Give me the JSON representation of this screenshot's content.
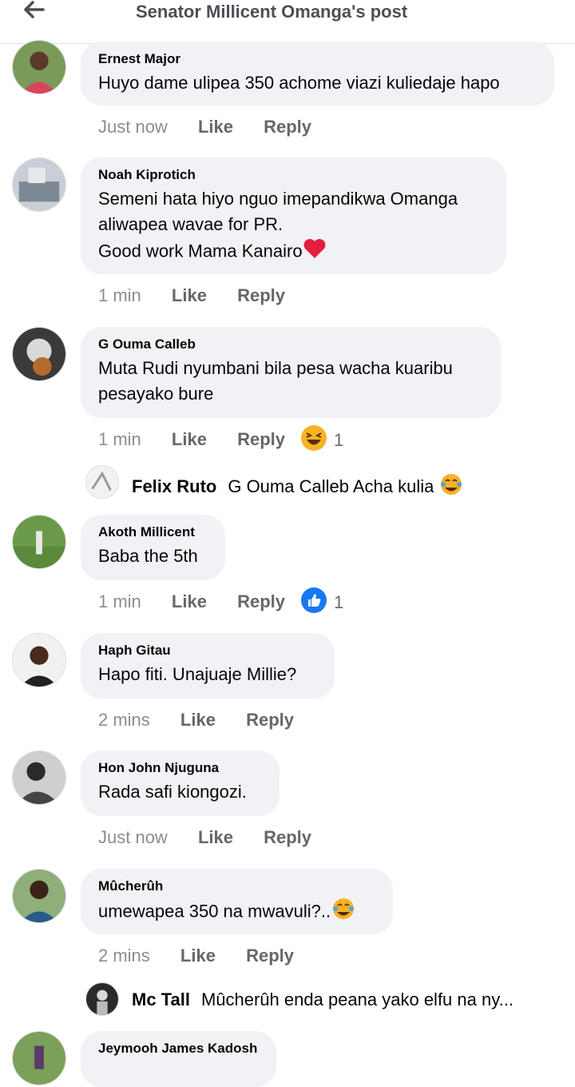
{
  "header": {
    "title": "Senator Millicent Omanga's post"
  },
  "comments": [
    {
      "author": "Ernest Major",
      "lines": [
        "Huyo dame ulipea 350 achome viazi kuliedaje hapo"
      ],
      "time": "Just now",
      "like": "Like",
      "reply": "Reply"
    },
    {
      "author": "Noah Kiprotich",
      "lines": [
        "Semeni hata hiyo nguo imepandikwa Omanga",
        "aliwapea wavae for PR.",
        "Good work Mama Kanairo"
      ],
      "time": "1 min",
      "like": "Like",
      "reply": "Reply"
    },
    {
      "author": "G Ouma Calleb",
      "lines": [
        "Muta Rudi nyumbani bila pesa wacha kuaribu",
        "pesayako bure"
      ],
      "time": "1 min",
      "like": "Like",
      "reply": "Reply",
      "reaction_count": "1"
    },
    {
      "author": "Akoth Millicent",
      "lines": [
        "Baba the 5th"
      ],
      "time": "1 min",
      "like": "Like",
      "reply": "Reply",
      "reaction_count": "1"
    },
    {
      "author": "Haph Gitau",
      "lines": [
        "Hapo fiti. Unajuaje Millie?"
      ],
      "time": "2 mins",
      "like": "Like",
      "reply": "Reply"
    },
    {
      "author": "Hon John Njuguna",
      "lines": [
        "Rada safi kiongozi."
      ],
      "time": "Just now",
      "like": "Like",
      "reply": "Reply"
    },
    {
      "author": "Mûcherûh",
      "lines": [
        "umewapea 350 na mwavuli?.."
      ],
      "time": "2 mins",
      "like": "Like",
      "reply": "Reply"
    },
    {
      "author": "Jeymooh James Kadosh",
      "lines": [
        ""
      ]
    }
  ],
  "replies": [
    {
      "author": "Felix Ruto",
      "text": "G Ouma Calleb Acha kulia"
    },
    {
      "author": "Mc Tall",
      "text": "Mûcherûh enda peana yako elfu na ny..."
    }
  ],
  "colors": {
    "bubble": "#f0f2f5",
    "like_blue": "#1877f2",
    "heart": "#e41e3f",
    "laugh": "#f7b125"
  }
}
